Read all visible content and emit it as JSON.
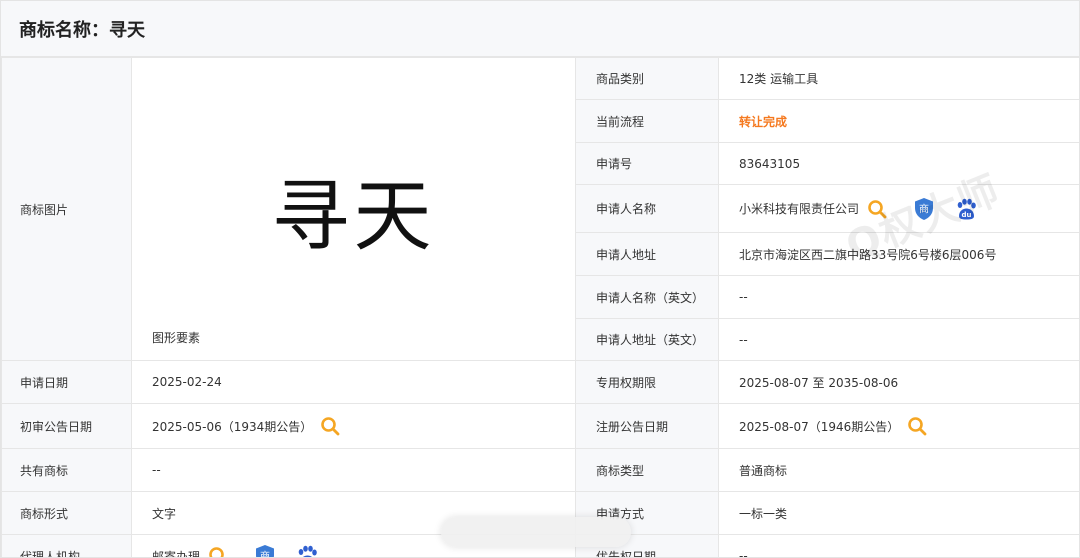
{
  "header": {
    "title": "商标名称：寻天"
  },
  "image": {
    "trademark_text": "寻天",
    "caption": "图形要素"
  },
  "labels": {
    "image": "商标图片",
    "category": "商品类别",
    "process": "当前流程",
    "reg_no": "申请号",
    "applicant": "申请人名称",
    "address": "申请人地址",
    "applicant_en": "申请人名称（英文）",
    "address_en": "申请人地址（英文）",
    "apply_date": "申请日期",
    "exclusive_period": "专用权期限",
    "prelim_date": "初审公告日期",
    "reg_date": "注册公告日期",
    "shared": "共有商标",
    "tm_type": "商标类型",
    "tm_form": "商标形式",
    "apply_method": "申请方式",
    "agent": "代理人机构",
    "priority": "优先权日期"
  },
  "values": {
    "category": "12类 运输工具",
    "process": "转让完成",
    "reg_no": "83643105",
    "applicant": "小米科技有限责任公司",
    "address": "北京市海淀区西二旗中路33号院6号楼6层006号",
    "applicant_en": "--",
    "address_en": "--",
    "apply_date": "2025-02-24",
    "exclusive_period": "2025-08-07 至 2035-08-06",
    "prelim_date": "2025-05-06（1934期公告）",
    "reg_date": "2025-08-07（1946期公告）",
    "shared": "--",
    "tm_type": "普通商标",
    "tm_form": "文字",
    "apply_method": "一标一类",
    "agent": "邮寄办理",
    "priority": "--"
  },
  "icons": {
    "search": "search-icon",
    "shield": "shang-shield-icon",
    "baidu": "baidu-paw-icon",
    "shield_char": "商",
    "baidu_text": "du"
  },
  "watermark": "Q权大师",
  "colors": {
    "accent": "#f5791f",
    "search": "#f5a623",
    "shield": "#3a7bd5",
    "paw": "#2f5fd0"
  }
}
